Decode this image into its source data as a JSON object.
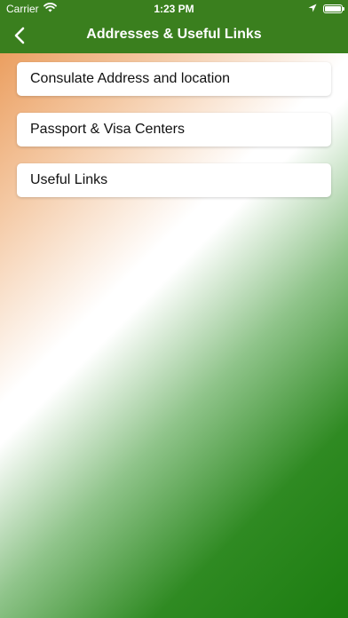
{
  "status_bar": {
    "carrier": "Carrier",
    "time": "1:23 PM",
    "icons": [
      "wifi-icon",
      "location-arrow-icon",
      "battery-icon"
    ]
  },
  "nav": {
    "title": "Addresses & Useful Links",
    "back_icon": "chevron-left-icon",
    "bar_color": "#3a7f1e"
  },
  "menu": {
    "items": [
      {
        "label": "Consulate Address and location"
      },
      {
        "label": "Passport & Visa Centers"
      },
      {
        "label": "Useful Links"
      }
    ]
  },
  "colors": {
    "saffron": "#e8914a",
    "white": "#ffffff",
    "green": "#1c7d10"
  }
}
